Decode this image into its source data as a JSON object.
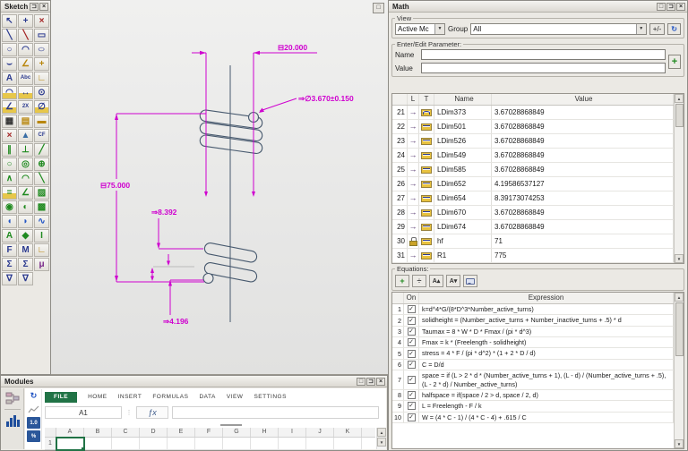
{
  "icons": {
    "check": "✓",
    "link_arrow": "→",
    "refresh": "↻",
    "dropdown_arrow": "▼",
    "scroll_up": "▲",
    "scroll_down": "▼"
  },
  "window_buttons": {
    "maximize": "□",
    "dock": "⊐",
    "close": "×"
  },
  "sketch_panel": {
    "title": "Sketch",
    "tools": [
      {
        "name": "select",
        "glyph": "↖",
        "color": "#2b3a8f"
      },
      {
        "name": "point-snap",
        "glyph": "+",
        "color": "#2b3a8f"
      },
      {
        "name": "trim",
        "glyph": "×",
        "color": "#a32424"
      },
      {
        "name": "line",
        "glyph": "╲",
        "color": "#2b3a8f"
      },
      {
        "name": "line-two-point",
        "glyph": "╲",
        "color": "#a32424"
      },
      {
        "name": "rectangle",
        "glyph": "▭",
        "color": "#2b3a8f"
      },
      {
        "name": "circle",
        "glyph": "○",
        "color": "#2b3a8f"
      },
      {
        "name": "arc",
        "glyph": "◠",
        "color": "#2b3a8f"
      },
      {
        "name": "ellipse",
        "glyph": "○",
        "color": "#2b3a8f",
        "wide": true
      },
      {
        "name": "fillet",
        "glyph": "⌣",
        "color": "#2b3a8f"
      },
      {
        "name": "chamfer",
        "glyph": "∠",
        "color": "#b8860b"
      },
      {
        "name": "construction-point",
        "glyph": "+",
        "color": "#b8860b"
      },
      {
        "name": "text-box",
        "glyph": "A",
        "color": "#2b3a8f"
      },
      {
        "name": "text",
        "glyph": "Abc",
        "color": "#2b3a8f"
      },
      {
        "name": "axis",
        "glyph": "∟",
        "color": "#b8860b"
      },
      {
        "name": "arc-dimension",
        "glyph": "◠",
        "color": "#2b3a8f",
        "dim": true
      },
      {
        "name": "linear-dimension",
        "glyph": "↔",
        "color": "#2b3a8f",
        "dim": true
      },
      {
        "name": "circle-dimension",
        "glyph": "⊙",
        "color": "#2b3a8f"
      },
      {
        "name": "angle-dimension",
        "glyph": "∠",
        "color": "#2b3a8f",
        "dim": true
      },
      {
        "name": "scale-dimension",
        "glyph": "2X",
        "color": "#2b3a8f"
      },
      {
        "name": "radius-dimension",
        "glyph": "∅",
        "color": "#2b3a8f",
        "dim": true
      },
      {
        "name": "pattern-grid",
        "glyph": "▦",
        "color": "#333333"
      },
      {
        "name": "dimension-table",
        "glyph": "▤",
        "color": "#b8860b"
      },
      {
        "name": "ruler",
        "glyph": "▬",
        "color": "#b8860b"
      },
      {
        "name": "delete-constraint",
        "glyph": "×",
        "color": "#a32424"
      },
      {
        "name": "mirror",
        "glyph": "▲",
        "color": "#3a6ea5"
      },
      {
        "name": "cf-toggle",
        "glyph": "CF",
        "color": "#2b3a8f"
      },
      {
        "name": "parallel-constraint",
        "glyph": "∥",
        "color": "#1f8a1f"
      },
      {
        "name": "perpendicular-constraint",
        "glyph": "⊥",
        "color": "#1f8a1f"
      },
      {
        "name": "tangent-constraint",
        "glyph": "╱",
        "color": "#1f8a1f"
      },
      {
        "name": "tangent-circle-constraint",
        "glyph": "○",
        "color": "#1f8a1f"
      },
      {
        "name": "concentric-constraint",
        "glyph": "◎",
        "color": "#1f8a1f"
      },
      {
        "name": "coincident-constraint",
        "glyph": "⊕",
        "color": "#1f8a1f"
      },
      {
        "name": "vertex-constraint",
        "glyph": "∧",
        "color": "#1f8a1f"
      },
      {
        "name": "arc-constraint",
        "glyph": "◠",
        "color": "#1f8a1f"
      },
      {
        "name": "slope-constraint",
        "glyph": "╲",
        "color": "#1f8a1f"
      },
      {
        "name": "equal-dimension",
        "glyph": "=",
        "color": "#1f8a1f",
        "dim": true
      },
      {
        "name": "angle-constraint",
        "glyph": "∠",
        "color": "#1f8a1f"
      },
      {
        "name": "fix-constraint",
        "glyph": "▨",
        "color": "#1f8a1f"
      },
      {
        "name": "filled-point",
        "glyph": "◉",
        "color": "#1f8a1f"
      },
      {
        "name": "half-point",
        "glyph": "◐",
        "color": "#1f8a1f"
      },
      {
        "name": "pattern-fill",
        "glyph": "▩",
        "color": "#1f8a1f"
      },
      {
        "name": "region-fill-left",
        "glyph": "◖",
        "color": "#2456c4"
      },
      {
        "name": "region-fill-right",
        "glyph": "◗",
        "color": "#2456c4"
      },
      {
        "name": "spline",
        "glyph": "∿",
        "color": "#2456c4"
      },
      {
        "name": "area-property",
        "glyph": "A",
        "color": "#1f8a1f"
      },
      {
        "name": "centroid-property",
        "glyph": "◆",
        "color": "#1f8a1f"
      },
      {
        "name": "inertia-property",
        "glyph": "I",
        "color": "#1f8a1f"
      },
      {
        "name": "force-load",
        "glyph": "F",
        "color": "#2b3a8f"
      },
      {
        "name": "moment-load",
        "glyph": "M",
        "color": "#2b3a8f"
      },
      {
        "name": "coordinate-system",
        "glyph": "∟",
        "color": "#b8860b"
      },
      {
        "name": "sum-xy",
        "glyph": "Σ",
        "color": "#2b3a8f"
      },
      {
        "name": "sum-n",
        "glyph": "Σ",
        "color": "#2b3a8f"
      },
      {
        "name": "friction-mu",
        "glyph": "μ",
        "color": "#7a2a8a"
      },
      {
        "name": "gradient-flip",
        "glyph": "∇",
        "color": "#2b3a8f"
      },
      {
        "name": "gradient-move",
        "glyph": "∇",
        "color": "#2b3a8f"
      }
    ]
  },
  "drawing": {
    "dimension_color": "#cf00cf",
    "geometry_color": "#47596e",
    "dim_width": {
      "prefix": "⊟",
      "value": "20.000"
    },
    "dim_wire": {
      "prefix": "⇒∅",
      "value": "3.670±0.150"
    },
    "dim_length": {
      "prefix": "⊟",
      "value": "75.000"
    },
    "dim_pitch": {
      "prefix": "⇒",
      "value": "8.392"
    },
    "dim_half": {
      "prefix": "⇒",
      "value": "4.196"
    }
  },
  "math_panel": {
    "title": "Math",
    "view": {
      "label": "View",
      "model_value": "Active Mc",
      "group_label": "Group",
      "group_value": "All",
      "plusminus_label": "+/-"
    },
    "parameter_editor": {
      "label": "Enter/Edit Parameter:",
      "name_label": "Name",
      "value_label": "Value",
      "name_value": "",
      "value_value": ""
    },
    "parameters": {
      "headers": {
        "l": "L",
        "t": "T",
        "name": "Name",
        "value": "Value"
      },
      "rows": [
        {
          "n": "21",
          "l": "arrow",
          "t": "radial",
          "name": "LDim373",
          "value": "3.67028868849"
        },
        {
          "n": "22",
          "l": "arrow",
          "t": "linear",
          "name": "LDim501",
          "value": "3.67028868849"
        },
        {
          "n": "23",
          "l": "arrow",
          "t": "linear",
          "name": "LDim526",
          "value": "3.67028868849"
        },
        {
          "n": "24",
          "l": "arrow",
          "t": "linear",
          "name": "LDim549",
          "value": "3.67028868849"
        },
        {
          "n": "25",
          "l": "arrow",
          "t": "linear",
          "name": "LDim585",
          "value": "3.67028868849"
        },
        {
          "n": "26",
          "l": "arrow",
          "t": "linear",
          "name": "LDim652",
          "value": "4.19586537127"
        },
        {
          "n": "27",
          "l": "arrow",
          "t": "linear",
          "name": "LDim654",
          "value": "8.39173074253"
        },
        {
          "n": "28",
          "l": "arrow",
          "t": "linear",
          "name": "LDim670",
          "value": "3.67028868849"
        },
        {
          "n": "29",
          "l": "arrow",
          "t": "linear",
          "name": "LDim674",
          "value": "3.67028868849"
        },
        {
          "n": "30",
          "l": "lock",
          "t": "linear",
          "name": "hf",
          "value": "71"
        },
        {
          "n": "31",
          "l": "arrow",
          "t": "linear",
          "name": "R1",
          "value": "775"
        }
      ]
    },
    "equations": {
      "label": "Equations:",
      "toolbar": [
        {
          "name": "add-equation",
          "glyph": "+",
          "color": "#1f8a1f"
        },
        {
          "name": "evaluate-fraction",
          "glyph": "÷",
          "color": "#555555"
        },
        {
          "name": "sort-ascending",
          "glyph": "A▴",
          "color": "#333333"
        },
        {
          "name": "sort-descending",
          "glyph": "A▾",
          "color": "#333333"
        },
        {
          "name": "comment",
          "glyph": "bubble",
          "color": "#5a6a9a"
        }
      ],
      "headers": {
        "on": "On",
        "expression": "Expression"
      },
      "rows": [
        {
          "n": "1",
          "on": true,
          "expr": "k=d^4*G/(8*D^3*Number_active_turns)"
        },
        {
          "n": "2",
          "on": true,
          "expr": "solidheight = (Number_active_turns + Number_inactive_turns + .5) * d"
        },
        {
          "n": "3",
          "on": true,
          "expr": "Taumax = 8 * W * D * Fmax / (pi * d^3)"
        },
        {
          "n": "4",
          "on": true,
          "expr": "Fmax = k * (Freelength - solidheight)"
        },
        {
          "n": "5",
          "on": true,
          "expr": "stress = 4 * F / (pi * d^2) * (1 + 2 * D / d)"
        },
        {
          "n": "6",
          "on": true,
          "expr": "C = D/d"
        },
        {
          "n": "7",
          "on": true,
          "expr": "space = if (L > 2 * d * (Number_active_turns + 1), (L - d) / (Number_active_turns + .5), (L - 2 * d) / Number_active_turns)"
        },
        {
          "n": "8",
          "on": true,
          "expr": "halfspace = if(space / 2 > d, space / 2, d)"
        },
        {
          "n": "9",
          "on": true,
          "expr": "L = Freelength - F / k"
        },
        {
          "n": "10",
          "on": true,
          "expr": "W = (4 * C - 1) / (4 * C - 4) + .615 / C"
        }
      ]
    }
  },
  "modules_panel": {
    "title": "Modules",
    "spreadsheet": {
      "tabs": [
        "FILE",
        "HOME",
        "INSERT",
        "FORMULAS",
        "DATA",
        "VIEW",
        "SETTINGS"
      ],
      "name_box": "A1",
      "fx_label": "ƒx",
      "formula_bar_value": "",
      "mini_icons": [
        {
          "name": "refresh",
          "glyph": "↻",
          "style": "blue"
        },
        {
          "name": "chart",
          "glyph": "∿",
          "style": "grey"
        },
        {
          "name": "number-format",
          "glyph": "1.0",
          "style": "fill"
        },
        {
          "name": "percent-format",
          "glyph": "%",
          "style": "fill"
        }
      ],
      "columns": [
        "A",
        "B",
        "C",
        "D",
        "E",
        "F",
        "G",
        "H",
        "I",
        "J",
        "K"
      ],
      "rows": [
        "1"
      ]
    }
  }
}
